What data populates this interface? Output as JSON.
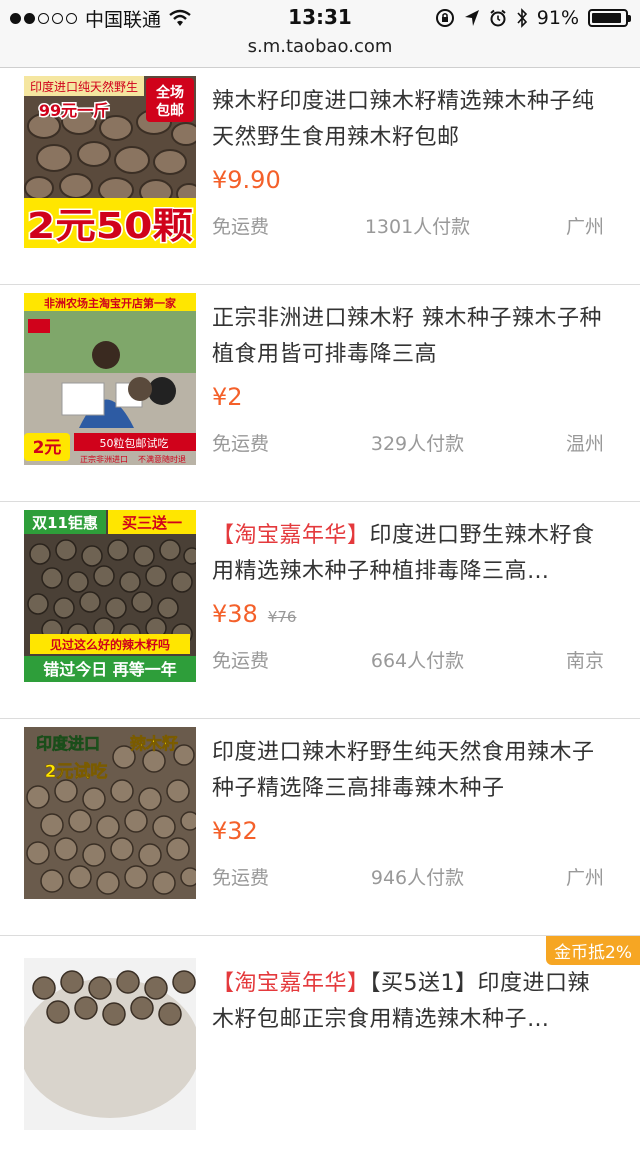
{
  "status_bar": {
    "carrier": "中国联通",
    "time": "13:31",
    "battery": "91%",
    "battery_level": 0.91
  },
  "url": "s.m.taobao.com",
  "products": [
    {
      "tag": "",
      "title": "辣木籽印度进口辣木籽精选辣木种子纯天然野生食用辣木籽包邮",
      "price": "¥9.90",
      "original_price": "",
      "shipping": "免运费",
      "sales": "1301人付款",
      "location": "广州",
      "thumb_text": [
        "印度进口纯天然野生",
        "99元一斤",
        "全场",
        "包邮",
        "2元50颗"
      ]
    },
    {
      "tag": "",
      "title": "正宗非洲进口辣木籽 辣木种子辣木子种植食用皆可排毒降三高",
      "price": "¥2",
      "original_price": "",
      "shipping": "免运费",
      "sales": "329人付款",
      "location": "温州",
      "thumb_text": [
        "非洲农场主淘宝开店第一家",
        "2元",
        "50粒包邮试吃",
        "正宗非洲进口",
        "不满意随时退"
      ]
    },
    {
      "tag": "【淘宝嘉年华】",
      "title": "印度进口野生辣木籽食用精选辣木种子种植排毒降三高…",
      "price": "¥38",
      "original_price": "¥76",
      "shipping": "免运费",
      "sales": "664人付款",
      "location": "南京",
      "thumb_text": [
        "双11钜惠",
        "买三送一",
        "见过这么好的辣木籽吗",
        "错过今日 再等一年"
      ]
    },
    {
      "tag": "",
      "title": "印度进口辣木籽野生纯天然食用辣木子种子精选降三高排毒辣木种子",
      "price": "¥32",
      "original_price": "",
      "shipping": "免运费",
      "sales": "946人付款",
      "location": "广州",
      "thumb_text": [
        "印度进口",
        "辣木籽",
        "2元试吃"
      ]
    },
    {
      "tag": "【淘宝嘉年华】",
      "title": "【买5送1】印度进口辣木籽包邮正宗食用精选辣木种子…",
      "price": "",
      "original_price": "",
      "shipping": "",
      "sales": "",
      "location": "",
      "badge": "金币抵2%"
    }
  ],
  "colors": {
    "price": "#f4602a",
    "tag": "#e4393c",
    "badge": "#f6a623"
  }
}
